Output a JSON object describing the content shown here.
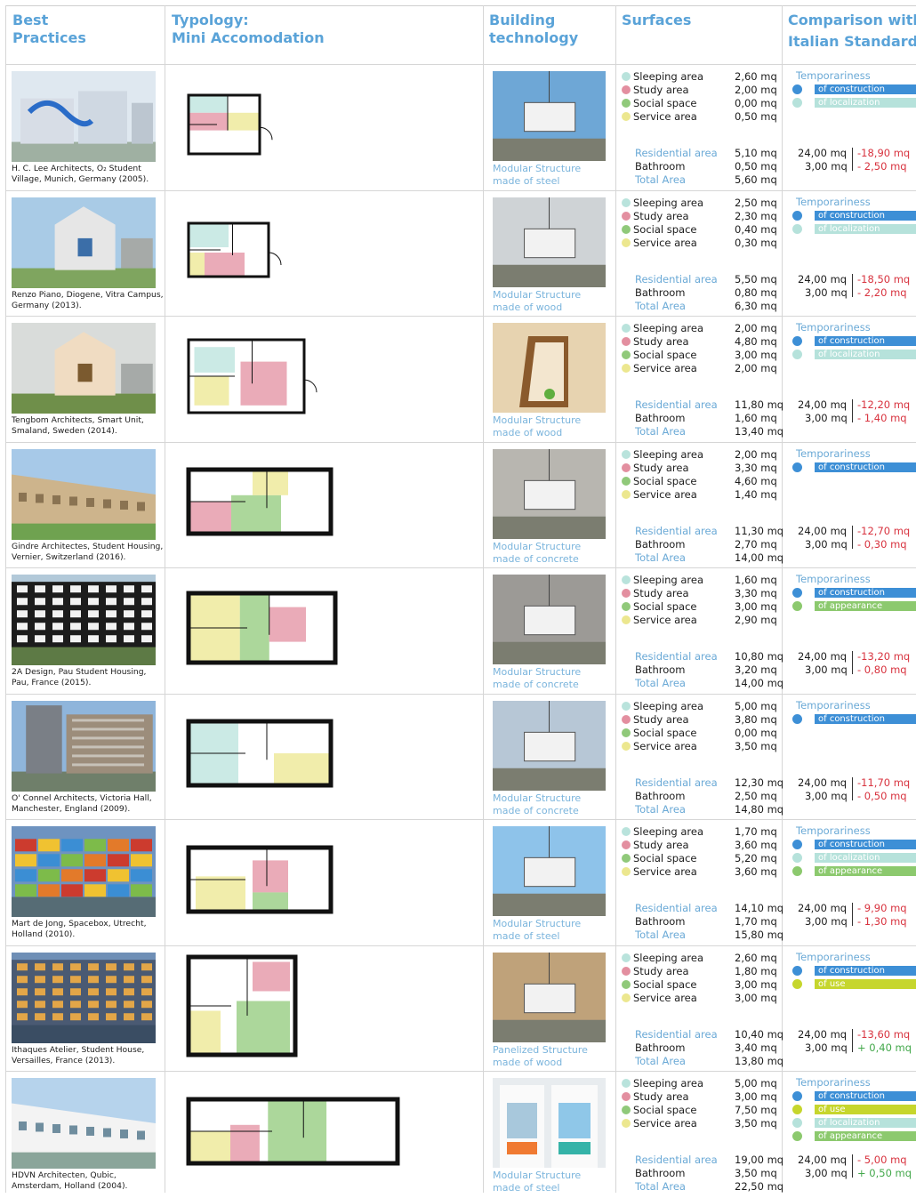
{
  "header": {
    "col1": "Best\nPractices",
    "col2": "Typology:\nMini Accomodation",
    "col3": "Building\ntechnology",
    "col4": "Surfaces",
    "col5": "Comparison with\nItalian Standards"
  },
  "labels": {
    "sleeping": "Sleeping area",
    "study": "Study area",
    "social": "Social space",
    "service": "Service area",
    "residential": "Residential area",
    "bathroom": "Bathroom",
    "total": "Total Area",
    "temporariness": "Temporariness",
    "std_res": "24,00 mq",
    "std_bath": "3,00 mq"
  },
  "colors": {
    "sleeping": "#b9e3dc",
    "study": "#e38fa0",
    "social": "#90c97a",
    "service": "#ece78f",
    "bathroom": "#ececec",
    "construction": "#3d8fd6",
    "localization": "#b6e2db",
    "appearance": "#8cc96e",
    "use": "#c6d62d"
  },
  "rows": [
    {
      "caption": "H. C. Lee Architects, O₂ Student Village, Munich, Germany (2005).",
      "tech": "Modular Structure\nmade of steel",
      "sleeping": "2,60 mq",
      "study": "2,00 mq",
      "social": "0,00 mq",
      "service": "0,50 mq",
      "residential": "5,10 mq",
      "bathroom": "0,50 mq",
      "total": "5,60 mq",
      "diff_res": "-18,90 mq",
      "diff_bath": "- 2,50 mq",
      "diff_bath_sign": "neg",
      "tags": [
        {
          "label": "of construction",
          "color": "construction"
        },
        {
          "label": "of localization",
          "color": "localization"
        }
      ]
    },
    {
      "caption": "Renzo Piano, Diogene, Vitra Campus, Germany (2013).",
      "tech": "Modular Structure\nmade of wood",
      "sleeping": "2,50 mq",
      "study": "2,30 mq",
      "social": "0,40 mq",
      "service": "0,30 mq",
      "residential": "5,50 mq",
      "bathroom": "0,80 mq",
      "total": "6,30 mq",
      "diff_res": "-18,50 mq",
      "diff_bath": "- 2,20 mq",
      "diff_bath_sign": "neg",
      "tags": [
        {
          "label": "of construction",
          "color": "construction"
        },
        {
          "label": "of localization",
          "color": "localization"
        }
      ]
    },
    {
      "caption": "Tengbom Architects, Smart Unit, Smaland, Sweden (2014).",
      "tech": "Modular Structure\nmade of wood",
      "sleeping": "2,00 mq",
      "study": "4,80 mq",
      "social": "3,00 mq",
      "service": "2,00 mq",
      "residential": "11,80 mq",
      "bathroom": "1,60 mq",
      "total": "13,40 mq",
      "diff_res": "-12,20 mq",
      "diff_bath": "- 1,40 mq",
      "diff_bath_sign": "neg",
      "tags": [
        {
          "label": "of construction",
          "color": "construction"
        },
        {
          "label": "of localization",
          "color": "localization"
        }
      ]
    },
    {
      "caption": "Gindre Architectes, Student Housing, Vernier, Switzerland (2016).",
      "tech": "Modular Structure\nmade of concrete",
      "sleeping": "2,00 mq",
      "study": "3,30 mq",
      "social": "4,60 mq",
      "service": "1,40 mq",
      "residential": "11,30 mq",
      "bathroom": "2,70 mq",
      "total": "14,00 mq",
      "diff_res": "-12,70 mq",
      "diff_bath": "- 0,30 mq",
      "diff_bath_sign": "neg",
      "tags": [
        {
          "label": "of construction",
          "color": "construction"
        }
      ]
    },
    {
      "caption": "2A Design, Pau Student Housing, Pau, France (2015).",
      "tech": "Modular Structure\nmade of concrete",
      "sleeping": "1,60 mq",
      "study": "3,30 mq",
      "social": "3,00 mq",
      "service": "2,90 mq",
      "residential": "10,80 mq",
      "bathroom": "3,20 mq",
      "total": "14,00 mq",
      "diff_res": "-13,20 mq",
      "diff_bath": "- 0,80 mq",
      "diff_bath_sign": "neg",
      "tags": [
        {
          "label": "of construction",
          "color": "construction"
        },
        {
          "label": "of appearance",
          "color": "appearance"
        }
      ]
    },
    {
      "caption": "O' Connel Architects, Victoria Hall, Manchester, England (2009).",
      "tech": "Modular Structure\nmade of concrete",
      "sleeping": "5,00 mq",
      "study": "3,80 mq",
      "social": "0,00 mq",
      "service": "3,50 mq",
      "residential": "12,30 mq",
      "bathroom": "2,50 mq",
      "total": "14,80 mq",
      "diff_res": "-11,70 mq",
      "diff_bath": "- 0,50 mq",
      "diff_bath_sign": "neg",
      "tags": [
        {
          "label": "of construction",
          "color": "construction"
        }
      ]
    },
    {
      "caption": "Mart de Jong, Spacebox, Utrecht, Holland (2010).",
      "tech": "Modular Structure\nmade of steel",
      "sleeping": "1,70 mq",
      "study": "3,60 mq",
      "social": "5,20 mq",
      "service": "3,60 mq",
      "residential": "14,10 mq",
      "bathroom": "1,70 mq",
      "total": "15,80 mq",
      "diff_res": "- 9,90 mq",
      "diff_bath": "- 1,30 mq",
      "diff_bath_sign": "neg",
      "tags": [
        {
          "label": "of construction",
          "color": "construction"
        },
        {
          "label": "of localization",
          "color": "localization"
        },
        {
          "label": "of appearance",
          "color": "appearance"
        }
      ]
    },
    {
      "caption": "Ithaques Atelier, Student House, Versailles, France (2013).",
      "tech": "Panelized Structure\nmade of wood",
      "sleeping": "2,60 mq",
      "study": "1,80 mq",
      "social": "3,00 mq",
      "service": "3,00 mq",
      "residential": "10,40 mq",
      "bathroom": "3,40 mq",
      "total": "13,80 mq",
      "diff_res": "-13,60 mq",
      "diff_bath": "+ 0,40 mq",
      "diff_bath_sign": "pos",
      "tags": [
        {
          "label": "of construction",
          "color": "construction"
        },
        {
          "label": "of use",
          "color": "use"
        }
      ]
    },
    {
      "caption": "HDVN Architecten, Qubic, Amsterdam, Holland (2004).",
      "tech": "Modular Structure\nmade of steel",
      "sleeping": "5,00 mq",
      "study": "3,00 mq",
      "social": "7,50 mq",
      "service": "3,50 mq",
      "residential": "19,00 mq",
      "bathroom": "3,50 mq",
      "total": "22,50 mq",
      "diff_res": "- 5,00 mq",
      "diff_bath": "+ 0,50 mq",
      "diff_bath_sign": "pos",
      "tags": [
        {
          "label": "of construction",
          "color": "construction"
        },
        {
          "label": "of use",
          "color": "use"
        },
        {
          "label": "of localization",
          "color": "localization"
        },
        {
          "label": "of appearance",
          "color": "appearance"
        }
      ]
    }
  ]
}
